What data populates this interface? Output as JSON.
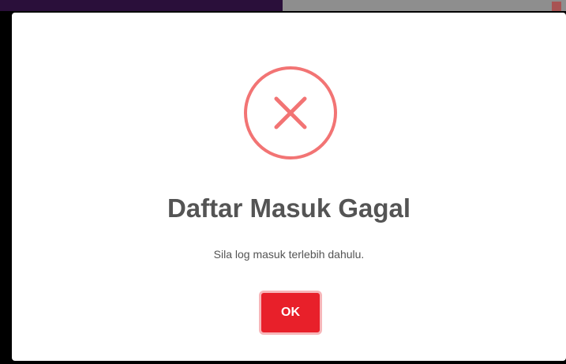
{
  "dialog": {
    "icon": "error-x-icon",
    "title": "Daftar Masuk Gagal",
    "message": "Sila log masuk terlebih dahulu.",
    "confirm_label": "OK"
  },
  "colors": {
    "icon": "#f27474",
    "button": "#e8202a",
    "button_border": "#f7b6b9",
    "text": "#545454"
  }
}
